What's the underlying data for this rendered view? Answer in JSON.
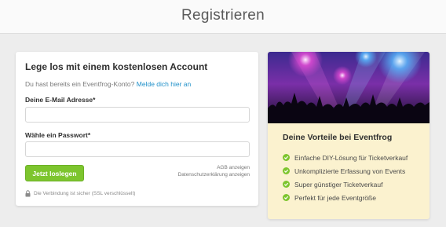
{
  "header": {
    "title": "Registrieren"
  },
  "form": {
    "title": "Lege los mit einem kostenlosen Account",
    "login_prompt": "Du hast bereits ein Eventfrog-Konto?",
    "login_link": "Melde dich hier an",
    "email_label": "Deine E-Mail Adresse*",
    "email_value": "",
    "password_label": "Wähle ein Passwort*",
    "password_value": "",
    "submit_label": "Jetzt loslegen",
    "agb_link": "AGB anzeigen",
    "privacy_link": "Datenschutzerklärung anzeigen",
    "ssl_notice": "Die Verbindung ist sicher (SSL verschlüsselt)",
    "lock_icon": "lock-icon"
  },
  "benefits": {
    "title": "Deine Vorteile bei Eventfrog",
    "check_icon": "check-circle-icon",
    "image": "concert-crowd-image",
    "items": [
      {
        "label": "Einfache DIY-Lösung für Ticketverkauf"
      },
      {
        "label": "Unkomplizierte Erfassung von Events"
      },
      {
        "label": "Super günstiger Ticketverkauf"
      },
      {
        "label": "Perfekt für jede Eventgröße"
      }
    ]
  },
  "colors": {
    "accent_green": "#7dc52e",
    "link_blue": "#1f90c9",
    "benefits_bg": "#fbf2cf",
    "page_bg": "#ededed"
  }
}
